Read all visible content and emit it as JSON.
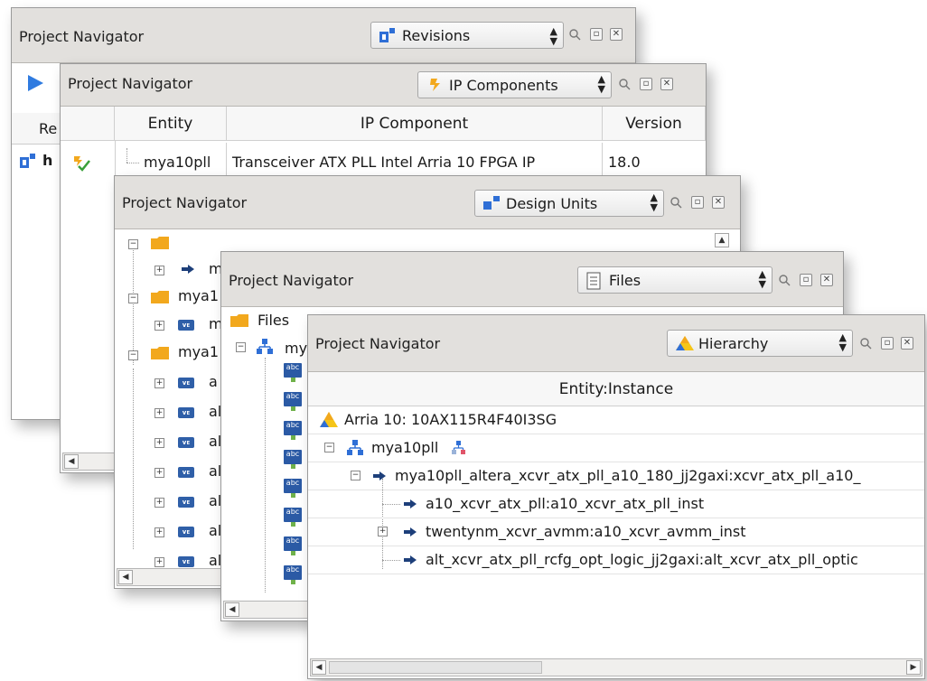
{
  "windows": {
    "revisions": {
      "title": "Project Navigator",
      "view": "Revisions",
      "col_header_partial": "Re",
      "row_partial": "h"
    },
    "ip_components": {
      "title": "Project Navigator",
      "view": "IP Components",
      "columns": [
        "Entity",
        "IP Component",
        "Version"
      ],
      "rows": [
        {
          "entity": "mya10pll",
          "ip_component": "Transceiver ATX PLL Intel Arria 10 FPGA IP",
          "version": "18.0"
        }
      ]
    },
    "design_units": {
      "title": "Project Navigator",
      "view": "Design Units",
      "items": [
        "m",
        "mya1",
        "m",
        "mya1",
        "a",
        "al",
        "al",
        "al",
        "al",
        "al",
        "al"
      ]
    },
    "files": {
      "title": "Project Navigator",
      "view": "Files",
      "root_label": "Files",
      "child_label": "my",
      "file_icon_text": "abc"
    },
    "hierarchy": {
      "title": "Project Navigator",
      "view": "Hierarchy",
      "column": "Entity:Instance",
      "device": "Arria 10: 10AX115R4F40I3SG",
      "top": "mya10pll",
      "level1": "mya10pll_altera_xcvr_atx_pll_a10_180_jj2gaxi:xcvr_atx_pll_a10_",
      "level2": [
        "a10_xcvr_atx_pll:a10_xcvr_atx_pll_inst",
        "twentynm_xcvr_avmm:a10_xcvr_avmm_inst",
        "alt_xcvr_atx_pll_rcfg_opt_logic_jj2gaxi:alt_xcvr_atx_pll_optic"
      ]
    }
  },
  "colors": {
    "titlebar": "#e2e0dd",
    "accent_blue": "#2f6fd6",
    "folder_orange": "#f2a81d",
    "intel_yellow": "#f5c518"
  }
}
